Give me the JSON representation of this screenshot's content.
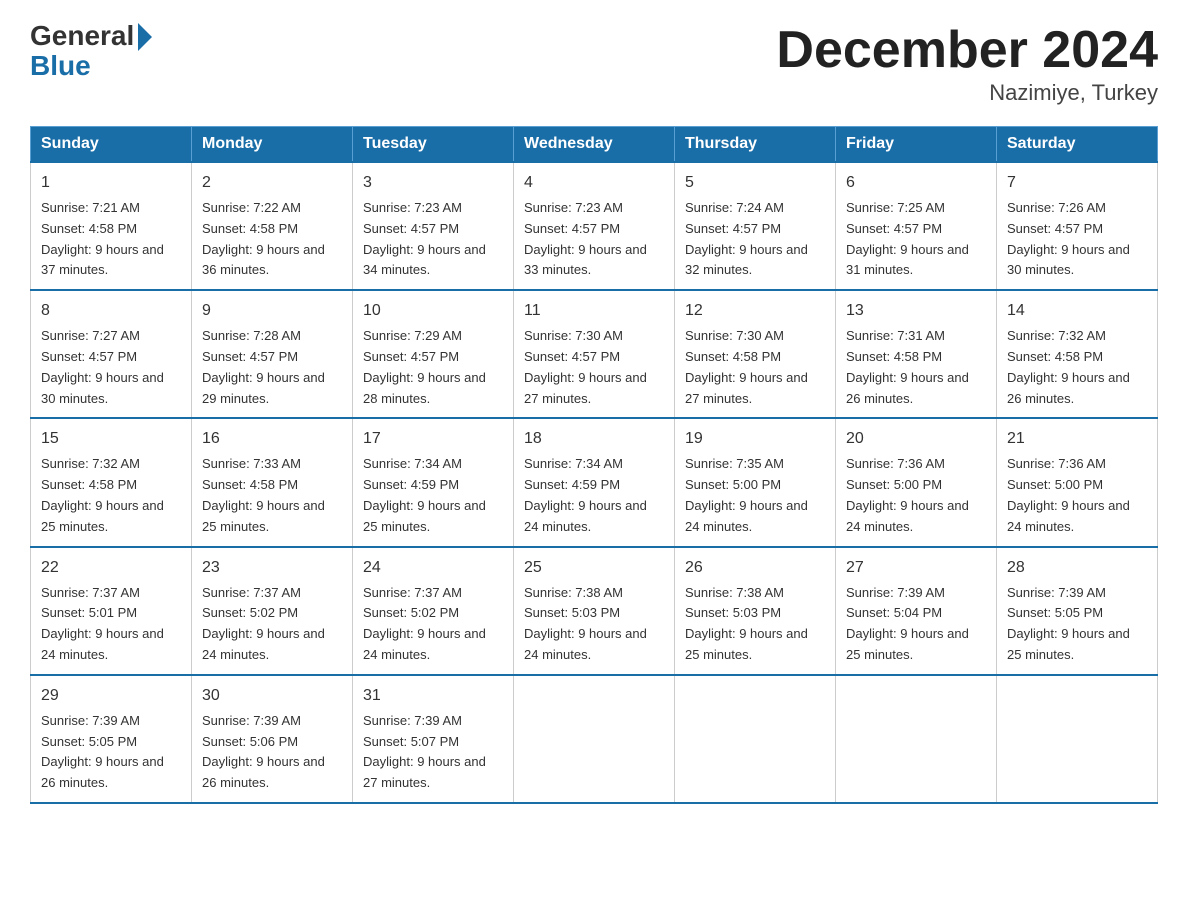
{
  "header": {
    "logo_general": "General",
    "logo_blue": "Blue",
    "month_title": "December 2024",
    "location": "Nazimiye, Turkey"
  },
  "days_of_week": [
    "Sunday",
    "Monday",
    "Tuesday",
    "Wednesday",
    "Thursday",
    "Friday",
    "Saturday"
  ],
  "weeks": [
    [
      {
        "day": "1",
        "sunrise": "7:21 AM",
        "sunset": "4:58 PM",
        "daylight": "9 hours and 37 minutes."
      },
      {
        "day": "2",
        "sunrise": "7:22 AM",
        "sunset": "4:58 PM",
        "daylight": "9 hours and 36 minutes."
      },
      {
        "day": "3",
        "sunrise": "7:23 AM",
        "sunset": "4:57 PM",
        "daylight": "9 hours and 34 minutes."
      },
      {
        "day": "4",
        "sunrise": "7:23 AM",
        "sunset": "4:57 PM",
        "daylight": "9 hours and 33 minutes."
      },
      {
        "day": "5",
        "sunrise": "7:24 AM",
        "sunset": "4:57 PM",
        "daylight": "9 hours and 32 minutes."
      },
      {
        "day": "6",
        "sunrise": "7:25 AM",
        "sunset": "4:57 PM",
        "daylight": "9 hours and 31 minutes."
      },
      {
        "day": "7",
        "sunrise": "7:26 AM",
        "sunset": "4:57 PM",
        "daylight": "9 hours and 30 minutes."
      }
    ],
    [
      {
        "day": "8",
        "sunrise": "7:27 AM",
        "sunset": "4:57 PM",
        "daylight": "9 hours and 30 minutes."
      },
      {
        "day": "9",
        "sunrise": "7:28 AM",
        "sunset": "4:57 PM",
        "daylight": "9 hours and 29 minutes."
      },
      {
        "day": "10",
        "sunrise": "7:29 AM",
        "sunset": "4:57 PM",
        "daylight": "9 hours and 28 minutes."
      },
      {
        "day": "11",
        "sunrise": "7:30 AM",
        "sunset": "4:57 PM",
        "daylight": "9 hours and 27 minutes."
      },
      {
        "day": "12",
        "sunrise": "7:30 AM",
        "sunset": "4:58 PM",
        "daylight": "9 hours and 27 minutes."
      },
      {
        "day": "13",
        "sunrise": "7:31 AM",
        "sunset": "4:58 PM",
        "daylight": "9 hours and 26 minutes."
      },
      {
        "day": "14",
        "sunrise": "7:32 AM",
        "sunset": "4:58 PM",
        "daylight": "9 hours and 26 minutes."
      }
    ],
    [
      {
        "day": "15",
        "sunrise": "7:32 AM",
        "sunset": "4:58 PM",
        "daylight": "9 hours and 25 minutes."
      },
      {
        "day": "16",
        "sunrise": "7:33 AM",
        "sunset": "4:58 PM",
        "daylight": "9 hours and 25 minutes."
      },
      {
        "day": "17",
        "sunrise": "7:34 AM",
        "sunset": "4:59 PM",
        "daylight": "9 hours and 25 minutes."
      },
      {
        "day": "18",
        "sunrise": "7:34 AM",
        "sunset": "4:59 PM",
        "daylight": "9 hours and 24 minutes."
      },
      {
        "day": "19",
        "sunrise": "7:35 AM",
        "sunset": "5:00 PM",
        "daylight": "9 hours and 24 minutes."
      },
      {
        "day": "20",
        "sunrise": "7:36 AM",
        "sunset": "5:00 PM",
        "daylight": "9 hours and 24 minutes."
      },
      {
        "day": "21",
        "sunrise": "7:36 AM",
        "sunset": "5:00 PM",
        "daylight": "9 hours and 24 minutes."
      }
    ],
    [
      {
        "day": "22",
        "sunrise": "7:37 AM",
        "sunset": "5:01 PM",
        "daylight": "9 hours and 24 minutes."
      },
      {
        "day": "23",
        "sunrise": "7:37 AM",
        "sunset": "5:02 PM",
        "daylight": "9 hours and 24 minutes."
      },
      {
        "day": "24",
        "sunrise": "7:37 AM",
        "sunset": "5:02 PM",
        "daylight": "9 hours and 24 minutes."
      },
      {
        "day": "25",
        "sunrise": "7:38 AM",
        "sunset": "5:03 PM",
        "daylight": "9 hours and 24 minutes."
      },
      {
        "day": "26",
        "sunrise": "7:38 AM",
        "sunset": "5:03 PM",
        "daylight": "9 hours and 25 minutes."
      },
      {
        "day": "27",
        "sunrise": "7:39 AM",
        "sunset": "5:04 PM",
        "daylight": "9 hours and 25 minutes."
      },
      {
        "day": "28",
        "sunrise": "7:39 AM",
        "sunset": "5:05 PM",
        "daylight": "9 hours and 25 minutes."
      }
    ],
    [
      {
        "day": "29",
        "sunrise": "7:39 AM",
        "sunset": "5:05 PM",
        "daylight": "9 hours and 26 minutes."
      },
      {
        "day": "30",
        "sunrise": "7:39 AM",
        "sunset": "5:06 PM",
        "daylight": "9 hours and 26 minutes."
      },
      {
        "day": "31",
        "sunrise": "7:39 AM",
        "sunset": "5:07 PM",
        "daylight": "9 hours and 27 minutes."
      },
      null,
      null,
      null,
      null
    ]
  ]
}
